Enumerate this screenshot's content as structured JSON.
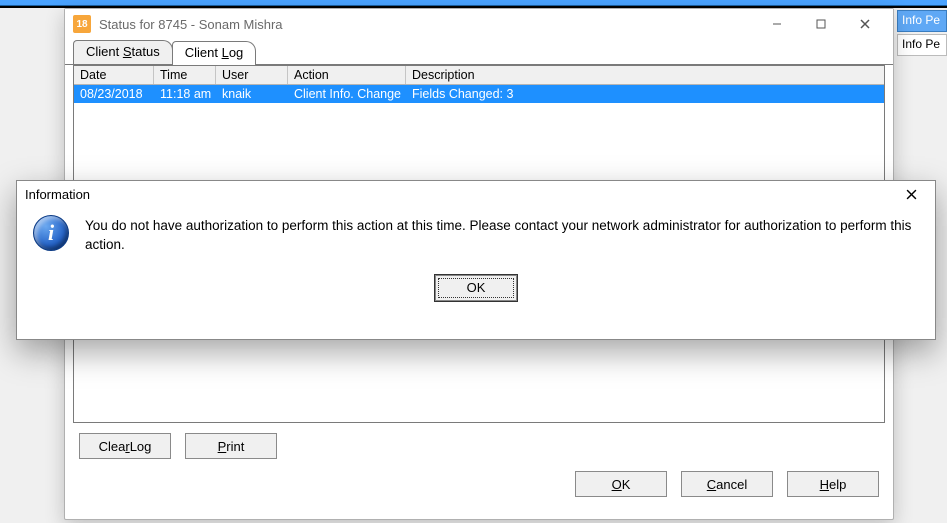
{
  "bg": {
    "info_btn": "Info Pe"
  },
  "status_window": {
    "title": "Status for 8745 - Sonam Mishra",
    "app_icon_text": "18",
    "tabs": {
      "client_status_prefix": "Client ",
      "client_status_ul": "S",
      "client_status_suffix": "tatus",
      "client_log_prefix": "Client ",
      "client_log_ul": "L",
      "client_log_suffix": "og"
    },
    "columns": {
      "date": "Date",
      "time": "Time",
      "user": "User",
      "action": "Action",
      "description": "Description"
    },
    "row": {
      "date": "08/23/2018",
      "time": "11:18 am",
      "user": "knaik",
      "action": "Client Info. Change",
      "description": "Fields Changed: 3"
    },
    "buttons": {
      "clear_prefix": "Clea",
      "clear_ul": "r",
      "clear_suffix": " Log",
      "print_ul": "P",
      "print_suffix": "rint",
      "ok_ul": "O",
      "ok_suffix": "K",
      "cancel_ul": "C",
      "cancel_suffix": "ancel",
      "help_ul": "H",
      "help_suffix": "elp"
    }
  },
  "info_dialog": {
    "title": "Information",
    "message": "You do not have authorization to perform this action at this time. Please contact your network administrator for authorization to perform this action.",
    "ok_label": "OK"
  }
}
